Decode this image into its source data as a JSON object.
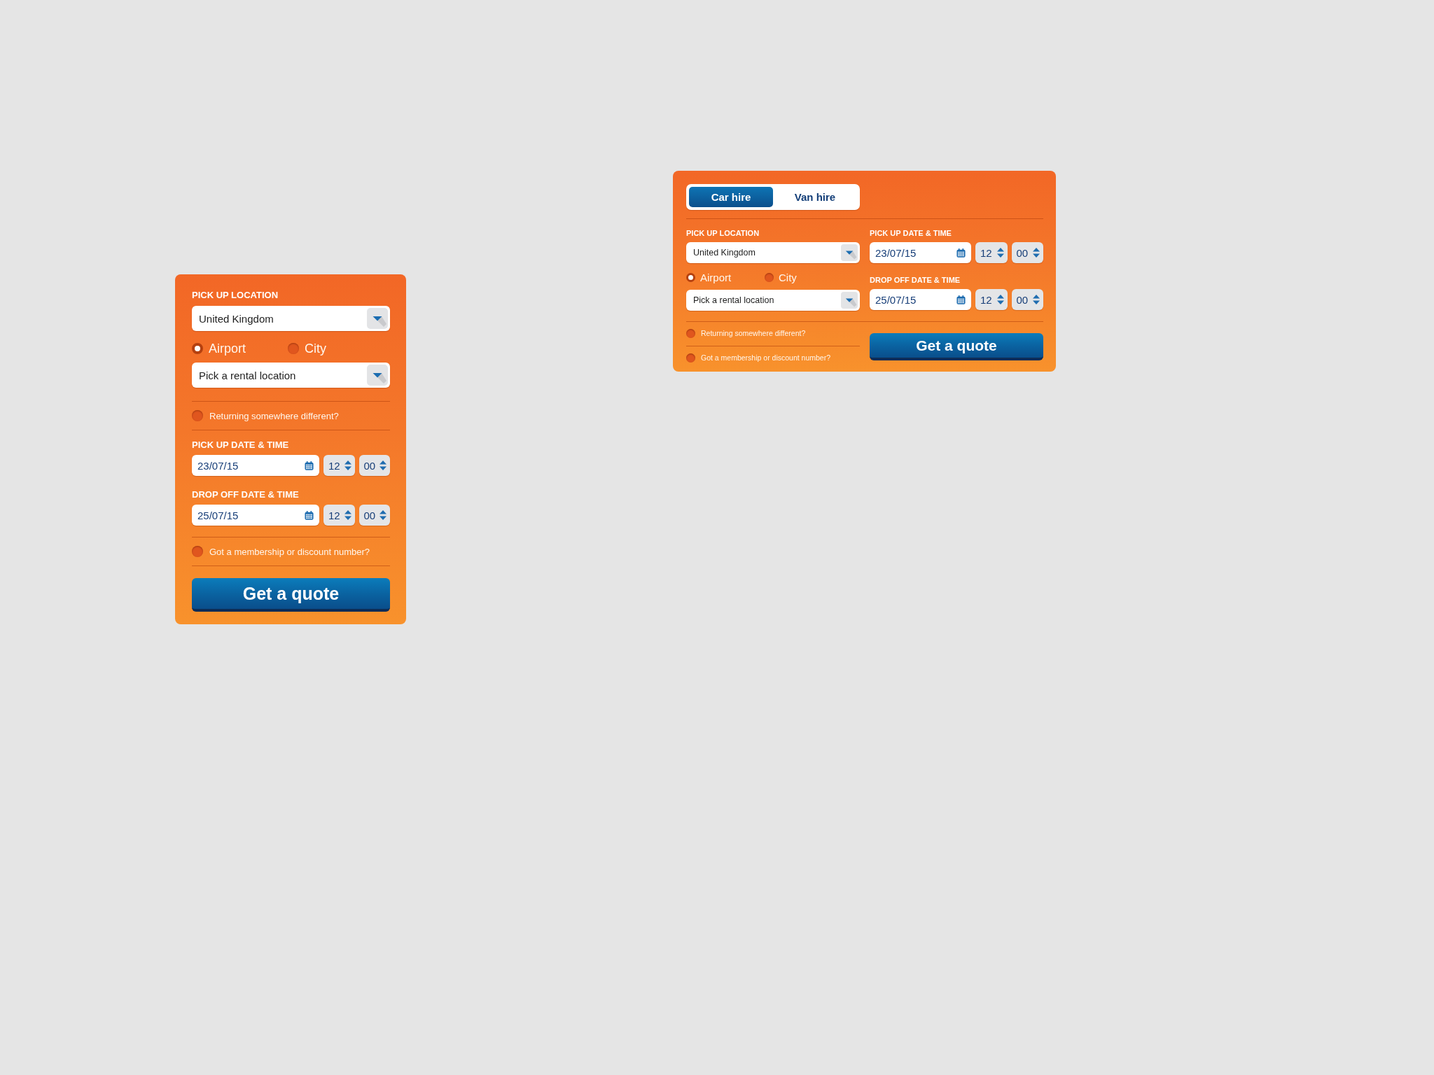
{
  "compact_form": {
    "pickup_location": {
      "label": "PICK UP LOCATION",
      "country": {
        "value": "United Kingdom"
      },
      "location_types": [
        {
          "label": "Airport",
          "selected": true
        },
        {
          "label": "City",
          "selected": false
        }
      ],
      "rental_location": {
        "placeholder": "Pick a rental location"
      }
    },
    "return_elsewhere": {
      "label": "Returning somewhere different?",
      "checked": false
    },
    "pickup_time": {
      "label": "PICK UP DATE & TIME",
      "date": "23/07/15",
      "hour": "12",
      "minute": "00"
    },
    "dropoff_time": {
      "label": "DROP OFF DATE & TIME",
      "date": "25/07/15",
      "hour": "12",
      "minute": "00"
    },
    "membership": {
      "label": "Got a membership or discount number?",
      "checked": false
    },
    "submit_button": "Get a quote"
  },
  "wide_form": {
    "tabs": [
      {
        "label": "Car hire",
        "selected": true
      },
      {
        "label": "Van hire",
        "selected": false
      }
    ],
    "pickup_location": {
      "label": "PICK UP LOCATION",
      "country": {
        "value": "United Kingdom"
      },
      "location_types": [
        {
          "label": "Airport",
          "selected": true
        },
        {
          "label": "City",
          "selected": false
        }
      ],
      "rental_location": {
        "placeholder": "Pick a rental location"
      }
    },
    "pickup_time": {
      "label": "PICK UP DATE & TIME",
      "date": "23/07/15",
      "hour": "12",
      "minute": "00"
    },
    "dropoff_time": {
      "label": "DROP OFF DATE & TIME",
      "date": "25/07/15",
      "hour": "12",
      "minute": "00"
    },
    "return_elsewhere": {
      "label": "Returning somewhere different?",
      "checked": false
    },
    "membership": {
      "label": "Got a membership or discount number?",
      "checked": false
    },
    "submit_button": "Get a quote"
  }
}
